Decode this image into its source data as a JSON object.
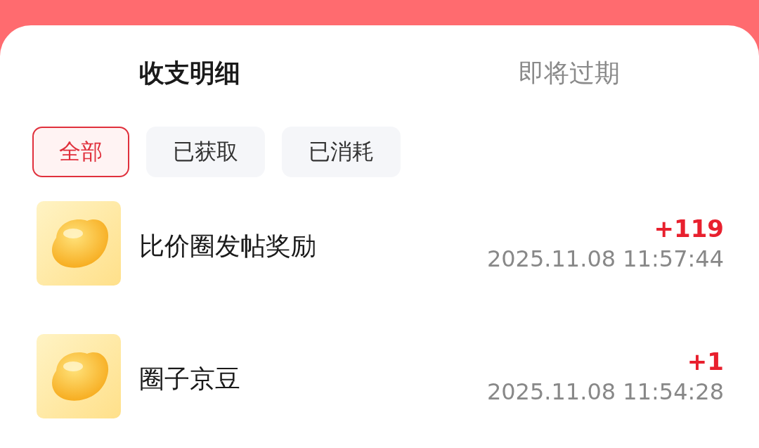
{
  "tabs": [
    {
      "label": "收支明细",
      "selected": true
    },
    {
      "label": "即将过期",
      "selected": false
    }
  ],
  "filters": [
    {
      "label": "全部",
      "selected": true
    },
    {
      "label": "已获取",
      "selected": false
    },
    {
      "label": "已消耗",
      "selected": false
    }
  ],
  "records": [
    {
      "title": "比价圈发帖奖励",
      "amount": "+119",
      "time": "2025.11.08 11:57:44"
    },
    {
      "title": "圈子京豆",
      "amount": "+1",
      "time": "2025.11.08 11:54:28"
    }
  ]
}
